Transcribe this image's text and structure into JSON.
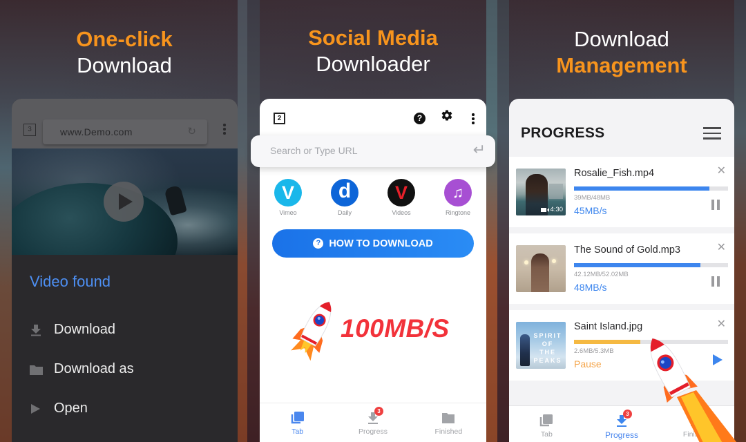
{
  "panels": [
    {
      "title_orange": "One-click",
      "title_white": "Download",
      "browser": {
        "tab_count": "3",
        "url": "www.Demo.com"
      },
      "sheet": {
        "heading": "Video found",
        "items": [
          {
            "label": "Download",
            "icon": "download-icon"
          },
          {
            "label": "Download as",
            "icon": "folder-icon"
          },
          {
            "label": "Open",
            "icon": "play-icon"
          }
        ]
      }
    },
    {
      "title_orange": "Social Media",
      "title_white": "Downloader",
      "toolbar": {
        "tab_count": "2"
      },
      "search": {
        "placeholder": "Search or Type URL"
      },
      "sites": [
        {
          "label": "Vimeo",
          "glyph": "V",
          "color": "#1ab7ea"
        },
        {
          "label": "Daily",
          "glyph": "d",
          "color": "#0d65d8"
        },
        {
          "label": "Videos",
          "glyph": "V",
          "color": "#111111"
        },
        {
          "label": "Ringtone",
          "glyph": "♫",
          "color": "#a74fd3"
        }
      ],
      "how_to_button": "HOW TO DOWNLOAD",
      "speed_banner": "100MB/S",
      "bottom_nav": [
        {
          "label": "Tab",
          "active": true
        },
        {
          "label": "Progress",
          "badge": "3"
        },
        {
          "label": "Finished"
        }
      ]
    },
    {
      "title_white": "Download",
      "title_orange": "Management",
      "header_title": "PROGRESS",
      "downloads": [
        {
          "name": "Rosalie_Fish.mp4",
          "size": "39MB/48MB",
          "status": "45MB/s",
          "progress": 0.88,
          "duration": "4:30",
          "bar_color": "#3d86ee",
          "status_color": "#3d86ee",
          "action": "pause"
        },
        {
          "name": "The Sound of Gold.mp3",
          "size": "42.12MB/52.02MB",
          "status": "48MB/s",
          "progress": 0.82,
          "bar_color": "#3d86ee",
          "status_color": "#3d86ee",
          "action": "pause"
        },
        {
          "name": "Saint Island.jpg",
          "size": "2.6MB/5.3MB",
          "status": "Pause",
          "progress": 0.43,
          "thumb_caption": "SPIRIT OF THE PEAKS",
          "bar_color": "#f5b942",
          "status_color": "#f5a54a",
          "action": "resume"
        }
      ],
      "bottom_nav": [
        {
          "label": "Tab"
        },
        {
          "label": "Progress",
          "badge": "3",
          "active": true
        },
        {
          "label": "Finished"
        }
      ]
    }
  ]
}
